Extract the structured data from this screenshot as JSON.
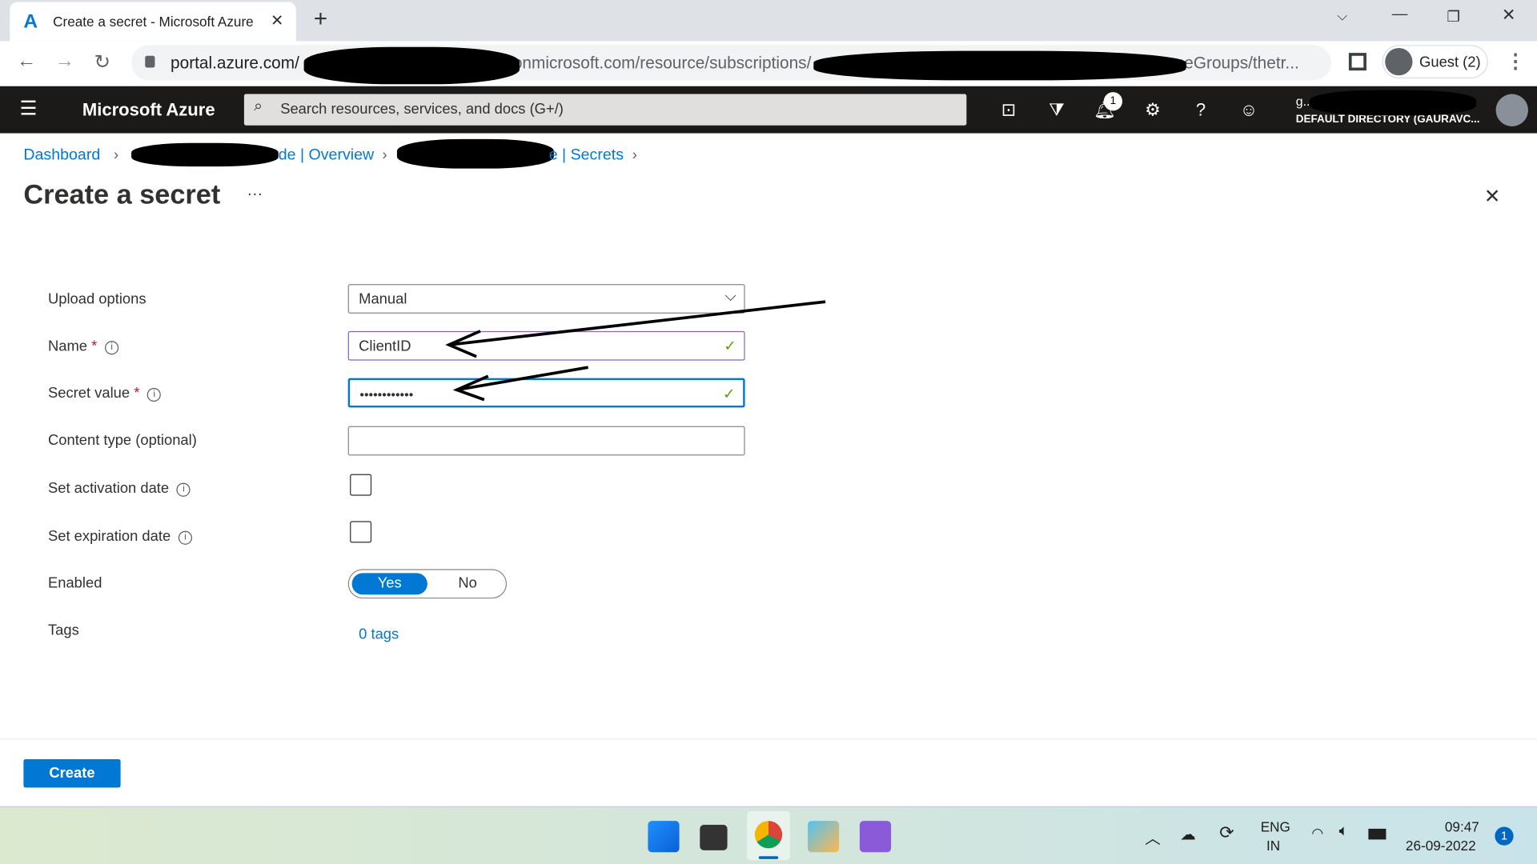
{
  "browser": {
    "tab_title": "Create a secret - Microsoft Azure",
    "new_tab": "+",
    "url_host": "portal.azure.com/",
    "url_mid": "onmicrosoft.com/resource/subscriptions/",
    "url_end": "ceGroups/thetr...",
    "profile": "Guest (2)"
  },
  "azure": {
    "brand": "Microsoft Azure",
    "search_placeholder": "Search resources, services, and docs (G+/)",
    "notification_count": "1",
    "user_email": "g...",
    "user_directory": "DEFAULT DIRECTORY (GAURAVC..."
  },
  "breadcrumb": [
    {
      "label": "Dashboard"
    },
    {
      "label": "de | Overview"
    },
    {
      "label": "e | Secrets"
    }
  ],
  "page": {
    "title": "Create a secret",
    "more": "···",
    "close": "✕"
  },
  "form": {
    "upload_label": "Upload options",
    "upload_value": "Manual",
    "name_label": "Name",
    "name_value": "ClientID",
    "secret_label": "Secret value",
    "secret_value": "••••••••••••",
    "content_label": "Content type (optional)",
    "content_value": "",
    "activation_label": "Set activation date",
    "activation_checked": false,
    "expiration_label": "Set expiration date",
    "expiration_checked": false,
    "enabled_label": "Enabled",
    "enabled_yes": "Yes",
    "enabled_no": "No",
    "enabled_value": "Yes",
    "tags_label": "Tags",
    "tags_link": "0 tags",
    "required_mark": "*"
  },
  "footer": {
    "create": "Create"
  },
  "taskbar": {
    "lang1": "ENG",
    "lang2": "IN",
    "time": "09:47",
    "date": "26-09-2022",
    "notif": "1"
  },
  "colors": {
    "accent": "#0078d4",
    "topbar": "#1b1a19",
    "valid": "#57a300"
  }
}
